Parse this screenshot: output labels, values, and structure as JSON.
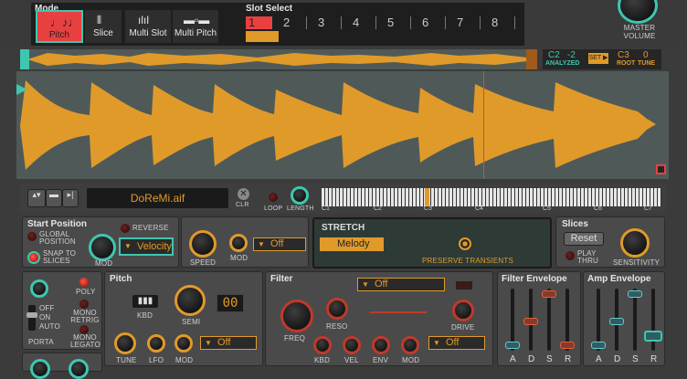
{
  "mode": {
    "title": "Mode",
    "tabs": [
      {
        "label": "Pitch",
        "icon": "notes-icon"
      },
      {
        "label": "Slice",
        "icon": "slice-icon"
      },
      {
        "label": "Multi Slot",
        "icon": "multi-slot-icon"
      },
      {
        "label": "Multi Pitch",
        "icon": "multi-pitch-icon"
      }
    ]
  },
  "slot_select": {
    "title": "Slot Select",
    "slots": [
      "1",
      "2",
      "3",
      "4",
      "5",
      "6",
      "7",
      "8"
    ]
  },
  "master": {
    "label": "MASTER\nVOLUME"
  },
  "overview": {
    "analyzed_note": "C2",
    "analyzed_cents": "-2",
    "analyzed_label": "ANALYZED",
    "set_label": "SET ▶",
    "root_note": "C3",
    "root_label": "ROOT",
    "tune_value": "0",
    "tune_label": "TUNE"
  },
  "file": {
    "name": "DoReMi.aif",
    "clr": "CLR",
    "loop": "LOOP",
    "length": "LENGTH",
    "keys": [
      "C1",
      "C2",
      "C3",
      "C4",
      "C5",
      "C6",
      "C7"
    ]
  },
  "start_position": {
    "title": "Start Position",
    "global": "GLOBAL POSITION",
    "snap": "SNAP TO SLICES",
    "reverse": "REVERSE",
    "mod": "MOD",
    "velocity": "Velocity"
  },
  "speed": {
    "speed": "SPEED",
    "mod": "MOD",
    "off": "Off"
  },
  "stretch": {
    "title": "STRETCH",
    "mode": "Melody",
    "preserve": "PRESERVE TRANSIENTS"
  },
  "slices": {
    "title": "Slices",
    "reset": "Reset",
    "play_thru": "PLAY THRU",
    "sensitivity": "SENSITIVITY"
  },
  "porta": {
    "off": "OFF",
    "on": "ON",
    "auto": "AUTO",
    "label": "PORTA",
    "poly": "POLY",
    "mono_retrig": "MONO RETRIG",
    "mono_legato": "MONO LEGATO"
  },
  "pitch": {
    "title": "Pitch",
    "kbd": "KBD",
    "semi": "SEMI",
    "semi_value": "00",
    "tune": "TUNE",
    "lfo": "LFO",
    "mod": "MOD",
    "off": "Off"
  },
  "filter": {
    "title": "Filter",
    "type": "Off",
    "freq": "FREQ",
    "reso": "RESO",
    "drive": "DRIVE",
    "kbd": "KBD",
    "vel": "VEL",
    "env": "ENV",
    "mod": "MOD",
    "off": "Off"
  },
  "filter_env": {
    "title": "Filter Envelope",
    "labels": [
      "A",
      "D",
      "S",
      "R"
    ]
  },
  "amp_env": {
    "title": "Amp Envelope",
    "labels": [
      "A",
      "D",
      "S",
      "R"
    ]
  },
  "colors": {
    "accent": "#e09a2a",
    "teal": "#3fc6b0",
    "red": "#e84040"
  }
}
